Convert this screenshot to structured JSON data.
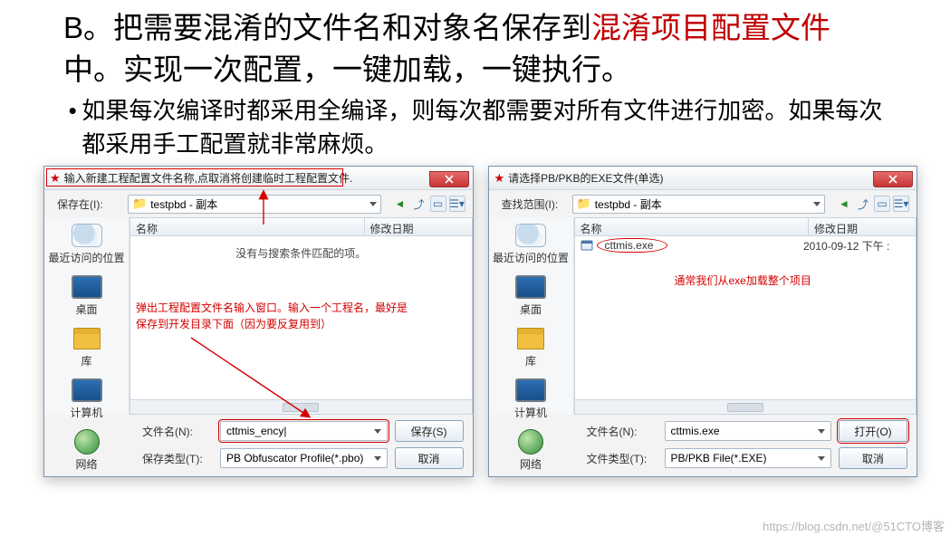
{
  "heading": {
    "prefix": "B。把需要混淆的文件名和对象名保存到",
    "highlight": "混淆项目配置文件",
    "suffix": "中。实现一次配置，一键加载，一键执行。"
  },
  "bullet": "如果每次编译时都采用全编译，则每次都需要对所有文件进行加密。如果每次都采用手工配置就非常麻烦。",
  "dialog_left": {
    "title": "输入新建工程配置文件名称,点取消将创建临时工程配置文件.",
    "save_in_label": "保存在(I):",
    "location": "testpbd - 副本",
    "columns": {
      "name": "名称",
      "date": "修改日期"
    },
    "empty_message": "没有与搜索条件匹配的项。",
    "annotation": "弹出工程配置文件名输入窗口。输入一个工程名，最好是保存到开发目录下面（因为要反复用到）",
    "filename_label": "文件名(N):",
    "filename_value": "cttmis_ency|",
    "filetype_label": "保存类型(T):",
    "filetype_value": "PB Obfuscator Profile(*.pbo)",
    "save_btn": "保存(S)",
    "cancel_btn": "取消",
    "places": [
      "最近访问的位置",
      "桌面",
      "库",
      "计算机",
      "网络"
    ]
  },
  "dialog_right": {
    "title": "请选择PB/PKB的EXE文件(单选)",
    "lookin_label": "查找范围(I):",
    "location": "testpbd - 副本",
    "columns": {
      "name": "名称",
      "date": "修改日期"
    },
    "file": {
      "name": "cttmis.exe",
      "date": "2010-09-12 下午 :"
    },
    "annotation": "通常我们从exe加载整个项目",
    "filename_label": "文件名(N):",
    "filename_value": "cttmis.exe",
    "filetype_label": "文件类型(T):",
    "filetype_value": "PB/PKB File(*.EXE)",
    "open_btn": "打开(O)",
    "cancel_btn": "取消",
    "places": [
      "最近访问的位置",
      "桌面",
      "库",
      "计算机",
      "网络"
    ]
  },
  "watermark": "https://blog.csdn.net/@51CTO博客"
}
